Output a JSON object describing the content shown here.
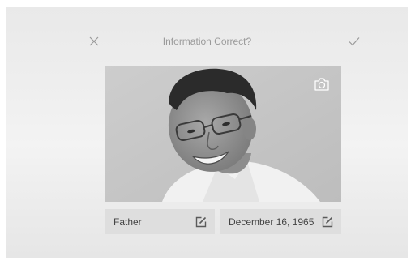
{
  "header": {
    "title": "Information Correct?",
    "close_icon": "close-icon",
    "confirm_icon": "checkmark-icon"
  },
  "photo": {
    "camera_icon": "camera-icon"
  },
  "fields": {
    "relation": "Father",
    "birth_date": "December 16, 1965",
    "edit_icon": "edit-icon"
  },
  "colors": {
    "background": "#eeeeee",
    "field_background": "#dedede",
    "title_text": "#9a9a9a"
  }
}
